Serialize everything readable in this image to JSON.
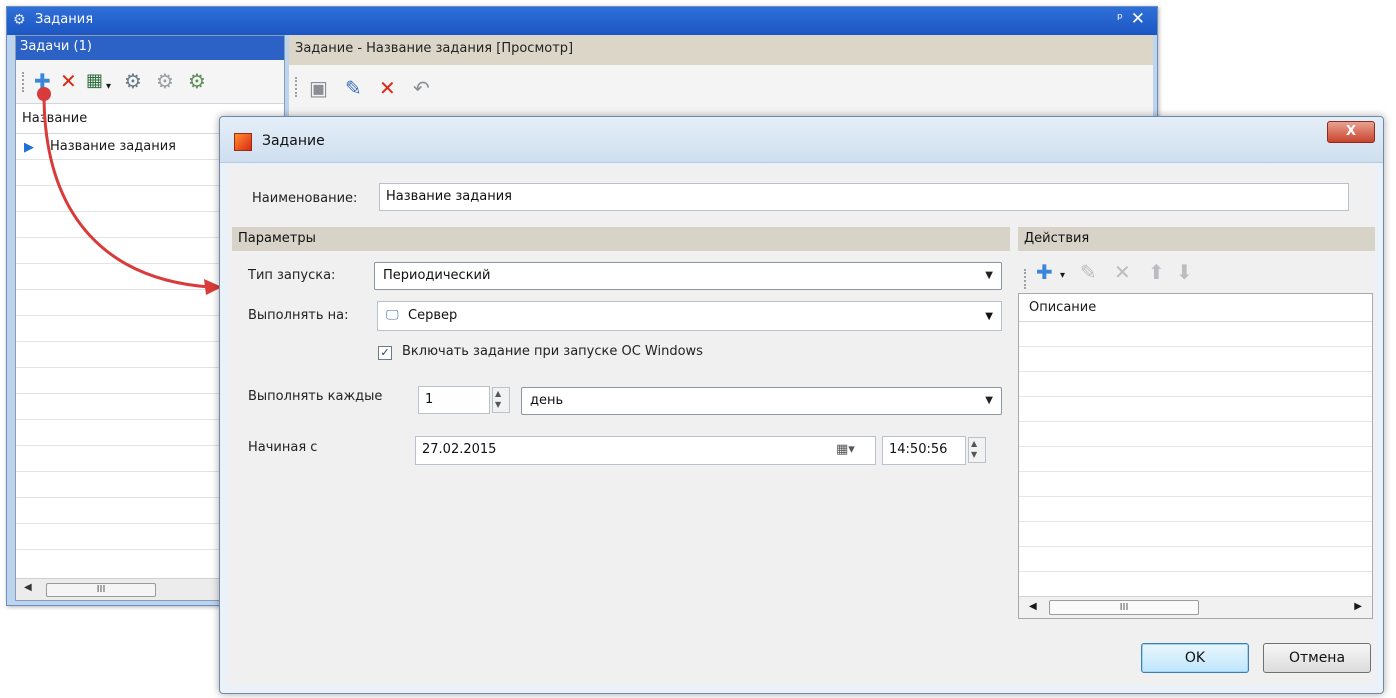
{
  "bg_window": {
    "title": "Задания",
    "pin": "ᵖ",
    "close": "✕",
    "left_panel": {
      "header": "Задачи (1)",
      "column": "Название",
      "rows": [
        "Название задания"
      ],
      "scroll_thumb": "III"
    },
    "right_panel": {
      "header": "Задание - Название задания [Просмотр]"
    }
  },
  "dialog": {
    "title": "Задание",
    "close": "X",
    "name_label": "Наименование:",
    "name_value": "Название задания",
    "params_header": "Параметры",
    "launch_type_label": "Тип запуска:",
    "launch_type_value": "Периодический",
    "run_on_label": "Выполнять на:",
    "run_on_value": "Сервер",
    "enable_on_start_label": "Включать задание при запуске ОС Windows",
    "enable_on_start_checked": true,
    "every_label": "Выполнять каждые",
    "every_value": "1",
    "period_value": "день",
    "start_label": "Начиная с",
    "start_date": "27.02.2015",
    "start_time": "14:50:56",
    "actions_header": "Действия",
    "actions_column": "Описание",
    "actions_scroll_thumb": "III",
    "ok": "OK",
    "cancel": "Отмена"
  },
  "colors": {
    "titlebar": "#1c56c2",
    "panel_header": "#2c62c6",
    "section_header": "#d8d3c8",
    "arrow": "#d93a3a"
  }
}
